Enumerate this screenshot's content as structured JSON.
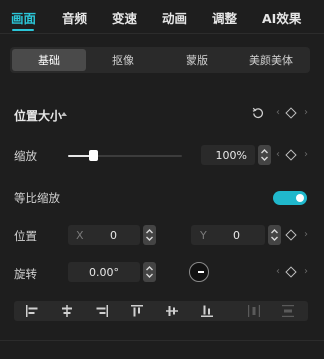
{
  "tabs": [
    {
      "label": "画面",
      "active": true
    },
    {
      "label": "音频"
    },
    {
      "label": "变速"
    },
    {
      "label": "动画"
    },
    {
      "label": "调整"
    },
    {
      "label": "AI效果"
    }
  ],
  "subtabs": [
    {
      "label": "基础",
      "active": true
    },
    {
      "label": "抠像"
    },
    {
      "label": "蒙版"
    },
    {
      "label": "美颜美体"
    }
  ],
  "section": {
    "title": "位置大小"
  },
  "scale": {
    "label": "缩放",
    "value": "100%",
    "slider_level": 0.22
  },
  "uniform_scale": {
    "label": "等比缩放",
    "enabled": true
  },
  "position": {
    "label": "位置",
    "x_label": "X",
    "x_value": "0",
    "y_label": "Y",
    "y_value": "0"
  },
  "rotation": {
    "label": "旋转",
    "value": "0.00°"
  },
  "colors": {
    "accent": "#2bc6d8",
    "toggle_on": "#20b8cc",
    "background": "#1e1e1e"
  },
  "icons": {
    "reset": "reset-icon",
    "keyframe": "keyframe-diamond-icon",
    "prev": "chevron-left-icon",
    "next": "chevron-right-icon",
    "align": [
      "align-left-icon",
      "align-center-horizontal-icon",
      "align-right-icon",
      "align-top-icon",
      "align-center-vertical-icon",
      "align-bottom-icon",
      "distribute-horizontal-icon",
      "distribute-vertical-icon"
    ]
  }
}
